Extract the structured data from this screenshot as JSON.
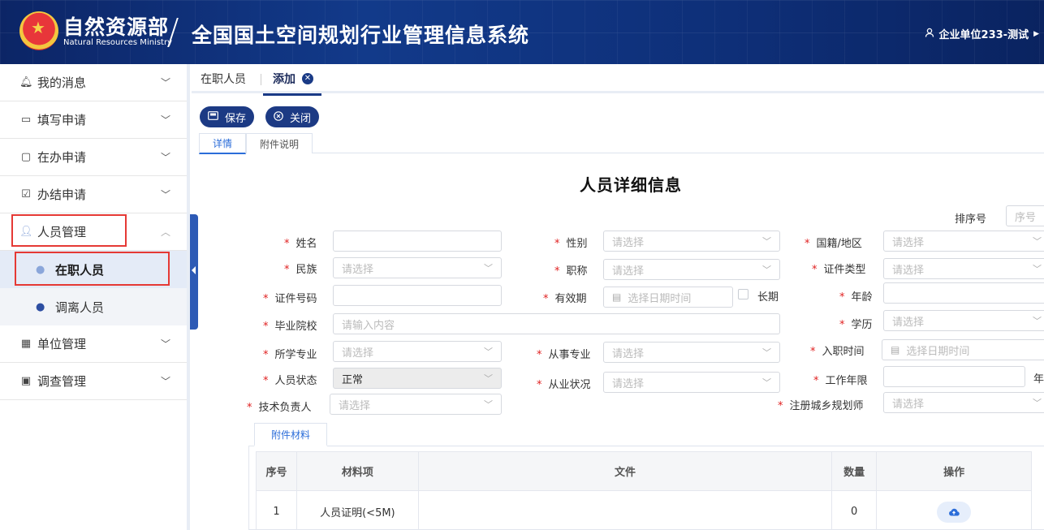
{
  "header": {
    "logo_cn": "自然资源部",
    "logo_en": "Natural Resources Ministry",
    "system_title": "全国国土空间规划行业管理信息系统",
    "user_name": "企业单位233-测试"
  },
  "sidebar": {
    "items": [
      {
        "label": "我的消息",
        "icon": "bell-icon"
      },
      {
        "label": "填写申请",
        "icon": "folder-icon"
      },
      {
        "label": "在办申请",
        "icon": "monitor-icon"
      },
      {
        "label": "办结申请",
        "icon": "calendar-check-icon"
      },
      {
        "label": "人员管理",
        "icon": "user-icon"
      },
      {
        "label": "单位管理",
        "icon": "building-icon"
      },
      {
        "label": "调查管理",
        "icon": "save-icon"
      }
    ],
    "sub_items": [
      {
        "label": "在职人员"
      },
      {
        "label": "调离人员"
      }
    ]
  },
  "tabs": {
    "tab1": "在职人员",
    "tab2": "添加"
  },
  "toolbar": {
    "save_label": "保存",
    "close_label": "关闭"
  },
  "subtabs": {
    "details": "详情",
    "attachment_notes": "附件说明"
  },
  "form": {
    "title": "人员详细信息",
    "sort_label": "排序号",
    "sort_placeholder": "序号",
    "select_placeholder": "请选择",
    "date_placeholder": "选择日期时间",
    "input_placeholder": "请输入内容",
    "labels": {
      "name": "姓名",
      "gender": "性别",
      "nationality": "国籍/地区",
      "ethnicity": "民族",
      "title": "职称",
      "cert_type": "证件类型",
      "cert_no": "证件号码",
      "validity": "有效期",
      "long_term": "长期",
      "age": "年龄",
      "school": "毕业院校",
      "education": "学历",
      "major": "所学专业",
      "work_major": "从事专业",
      "join_time": "入职时间",
      "status": "人员状态",
      "practice_status": "从业状况",
      "work_years": "工作年限",
      "year_unit": "年",
      "tech_lead": "技术负责人",
      "planner": "注册城乡规划师"
    },
    "status_value": "正常"
  },
  "attachments": {
    "tab_label": "附件材料",
    "columns": [
      "序号",
      "材料项",
      "文件",
      "数量",
      "操作"
    ],
    "rows": [
      {
        "no": "1",
        "item": "人员证明(<5M)",
        "file": "",
        "count": "0"
      }
    ]
  }
}
